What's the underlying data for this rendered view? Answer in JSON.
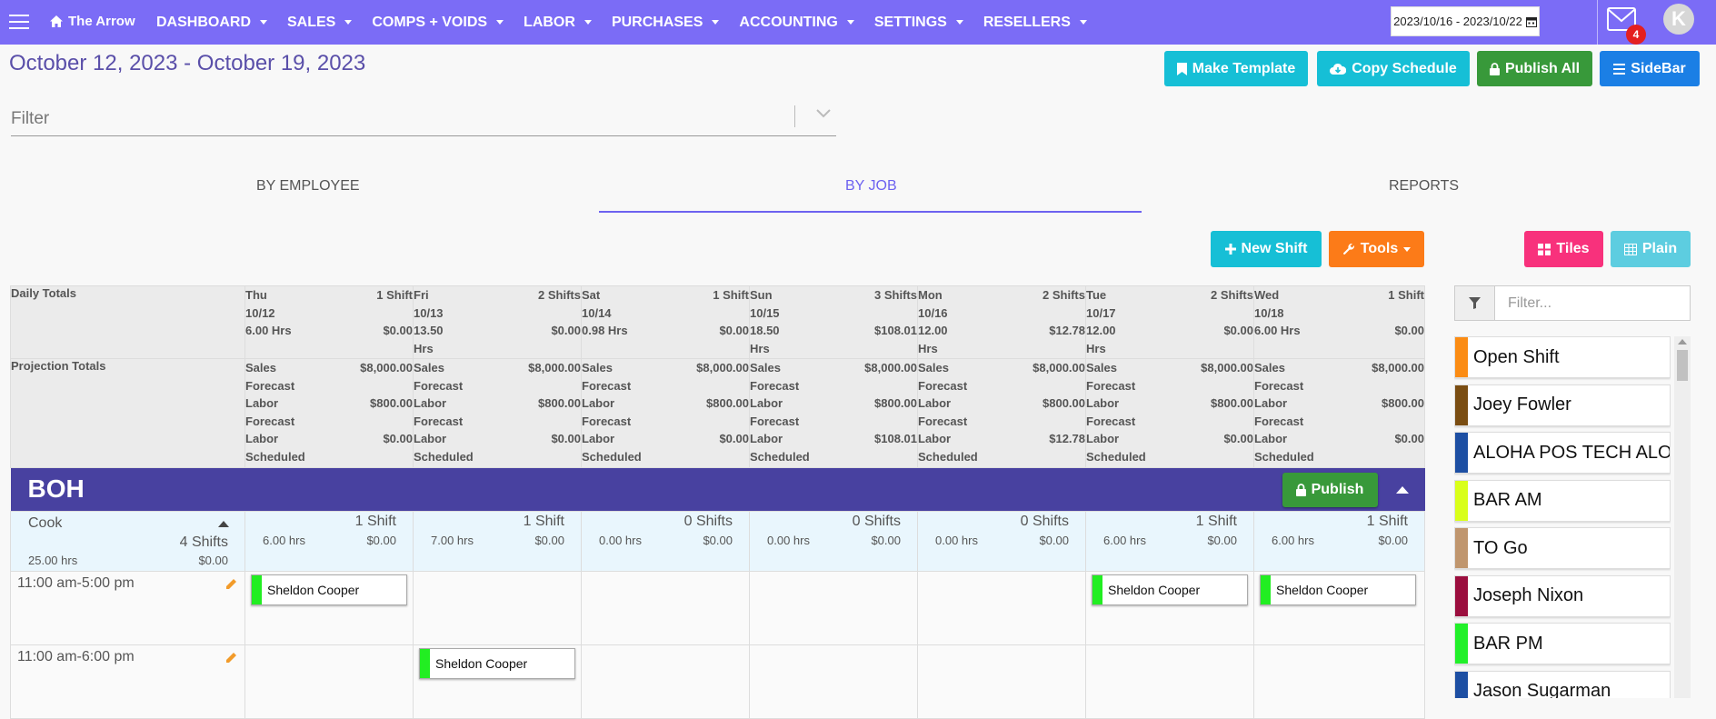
{
  "nav": {
    "brand": "The Arrow",
    "items": [
      "DASHBOARD",
      "SALES",
      "COMPS + VOIDS",
      "LABOR",
      "PURCHASES",
      "ACCOUNTING",
      "SETTINGS",
      "RESELLERS"
    ],
    "date_range": "2023/10/16 - 2023/10/22",
    "mail_count": "4",
    "avatar_initial": "K"
  },
  "header": {
    "period": "October 12, 2023 - October 19, 2023",
    "buttons": {
      "make_template": "Make Template",
      "copy_schedule": "Copy Schedule",
      "publish_all": "Publish All",
      "sidebar": "SideBar"
    },
    "filter_placeholder": "Filter"
  },
  "tabs": [
    "BY EMPLOYEE",
    "BY JOB",
    "REPORTS"
  ],
  "toolbar": {
    "new_shift": "New Shift",
    "tools": "Tools",
    "tiles": "Tiles",
    "plain": "Plain"
  },
  "colors": {
    "nav": "#7b6cf6",
    "group_header": "#4841a0",
    "teal": "#16bfd6",
    "green": "#38993a",
    "blue": "#1b7fe5",
    "orange": "#fc7b18",
    "pink": "#f8317c",
    "light_teal": "#5dcde0"
  },
  "totals": {
    "daily_label": "Daily Totals",
    "projection_label": "Projection Totals",
    "days": [
      {
        "day": "Thu",
        "date": "10/12",
        "shifts": "1 Shift",
        "hrs": "6.00 Hrs",
        "cost": "$0.00",
        "sales": "$8,000.00",
        "labor_fc": "$800.00",
        "labor_sch": "$0.00"
      },
      {
        "day": "Fri",
        "date": "10/13",
        "shifts": "2 Shifts",
        "hrs": "13.50 Hrs",
        "cost": "$0.00",
        "sales": "$8,000.00",
        "labor_fc": "$800.00",
        "labor_sch": "$0.00"
      },
      {
        "day": "Sat",
        "date": "10/14",
        "shifts": "1 Shift",
        "hrs": "0.98 Hrs",
        "cost": "$0.00",
        "sales": "$8,000.00",
        "labor_fc": "$800.00",
        "labor_sch": "$0.00"
      },
      {
        "day": "Sun",
        "date": "10/15",
        "shifts": "3 Shifts",
        "hrs": "18.50 Hrs",
        "cost": "$108.01",
        "sales": "$8,000.00",
        "labor_fc": "$800.00",
        "labor_sch": "$108.01"
      },
      {
        "day": "Mon",
        "date": "10/16",
        "shifts": "2 Shifts",
        "hrs": "12.00 Hrs",
        "cost": "$12.78",
        "sales": "$8,000.00",
        "labor_fc": "$800.00",
        "labor_sch": "$12.78"
      },
      {
        "day": "Tue",
        "date": "10/17",
        "shifts": "2 Shifts",
        "hrs": "12.00 Hrs",
        "cost": "$0.00",
        "sales": "$8,000.00",
        "labor_fc": "$800.00",
        "labor_sch": "$0.00"
      },
      {
        "day": "Wed",
        "date": "10/18",
        "shifts": "1 Shift",
        "hrs": "6.00 Hrs",
        "cost": "$0.00",
        "sales": "$8,000.00",
        "labor_fc": "$800.00",
        "labor_sch": "$0.00"
      }
    ],
    "sales_label": "Sales Forecast",
    "labor_fc_label": "Labor Forecast",
    "labor_sch_label": "Labor Scheduled"
  },
  "group": {
    "name": "BOH",
    "publish": "Publish"
  },
  "job": {
    "name": "Cook",
    "shifts": "4 Shifts",
    "hrs": "25.00 hrs",
    "cost": "$0.00",
    "days": [
      {
        "shifts": "1 Shift",
        "hrs": "6.00 hrs",
        "cost": "$0.00"
      },
      {
        "shifts": "1 Shift",
        "hrs": "7.00 hrs",
        "cost": "$0.00"
      },
      {
        "shifts": "0 Shifts",
        "hrs": "0.00 hrs",
        "cost": "$0.00"
      },
      {
        "shifts": "0 Shifts",
        "hrs": "0.00 hrs",
        "cost": "$0.00"
      },
      {
        "shifts": "0 Shifts",
        "hrs": "0.00 hrs",
        "cost": "$0.00"
      },
      {
        "shifts": "1 Shift",
        "hrs": "6.00 hrs",
        "cost": "$0.00"
      },
      {
        "shifts": "1 Shift",
        "hrs": "6.00 hrs",
        "cost": "$0.00"
      }
    ]
  },
  "shift_rows": [
    {
      "time": "11:00 am-5:00 pm",
      "cells": [
        "Sheldon Cooper",
        "",
        "",
        "",
        "",
        "Sheldon Cooper",
        "Sheldon Cooper"
      ]
    },
    {
      "time": "11:00 am-6:00 pm",
      "cells": [
        "",
        "Sheldon Cooper",
        "",
        "",
        "",
        "",
        ""
      ]
    }
  ],
  "sidebar": {
    "filter_placeholder": "Filter...",
    "jobs": [
      {
        "name": "Open Shift",
        "color": "#fb8c14"
      },
      {
        "name": "Joey Fowler",
        "color": "#7a4d12"
      },
      {
        "name": "ALOHA POS TECH ALOHA",
        "color": "#1d4fa3"
      },
      {
        "name": "BAR AM",
        "color": "#d9ff1a"
      },
      {
        "name": "TO Go",
        "color": "#c0966e"
      },
      {
        "name": "Joseph Nixon",
        "color": "#9b0e3e"
      },
      {
        "name": "BAR PM",
        "color": "#22f02a"
      },
      {
        "name": "Jason Sugarman",
        "color": "#1d4fa3"
      }
    ]
  }
}
